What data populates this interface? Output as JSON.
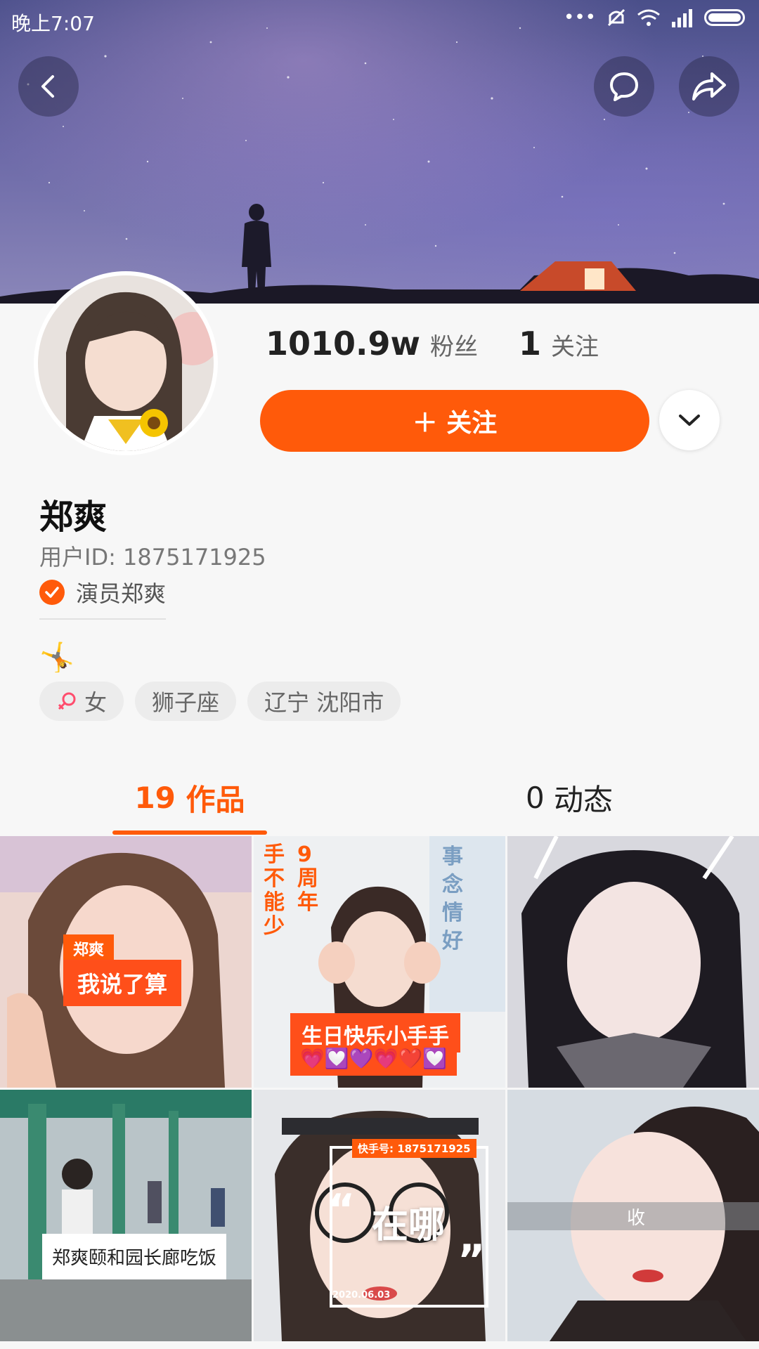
{
  "status_bar": {
    "time": "晚上7:07",
    "dots": "•••"
  },
  "profile": {
    "fans_count": "1010.9w",
    "fans_label": "粉丝",
    "following_count": "1",
    "following_label": "关注",
    "follow_button": "＋ 关注",
    "name": "郑爽",
    "user_id": "用户ID: 1875171925",
    "verified_text": "演员郑爽",
    "tags": [
      "女",
      "狮子座",
      "辽宁 沈阳市"
    ]
  },
  "tabs": [
    {
      "count": "19",
      "label": "作品"
    },
    {
      "count": "0",
      "label": "动态"
    }
  ],
  "videos": [
    {
      "tag": "郑爽",
      "caption": "我说了算"
    },
    {
      "side_text": "手不能少",
      "side_text2": "9周年",
      "caption": "生日快乐小手手",
      "hearts": "💗💟💜💗❤️💟",
      "right_text": "事念情好"
    },
    {
      "caption": ""
    },
    {
      "caption": "郑爽颐和园长廊吃饭"
    },
    {
      "watermark": "快手号: 1875171925",
      "caption": "在哪",
      "date": "2020.06.03"
    },
    {
      "caption": "收"
    }
  ],
  "colors": {
    "accent": "#ff5a0a"
  }
}
